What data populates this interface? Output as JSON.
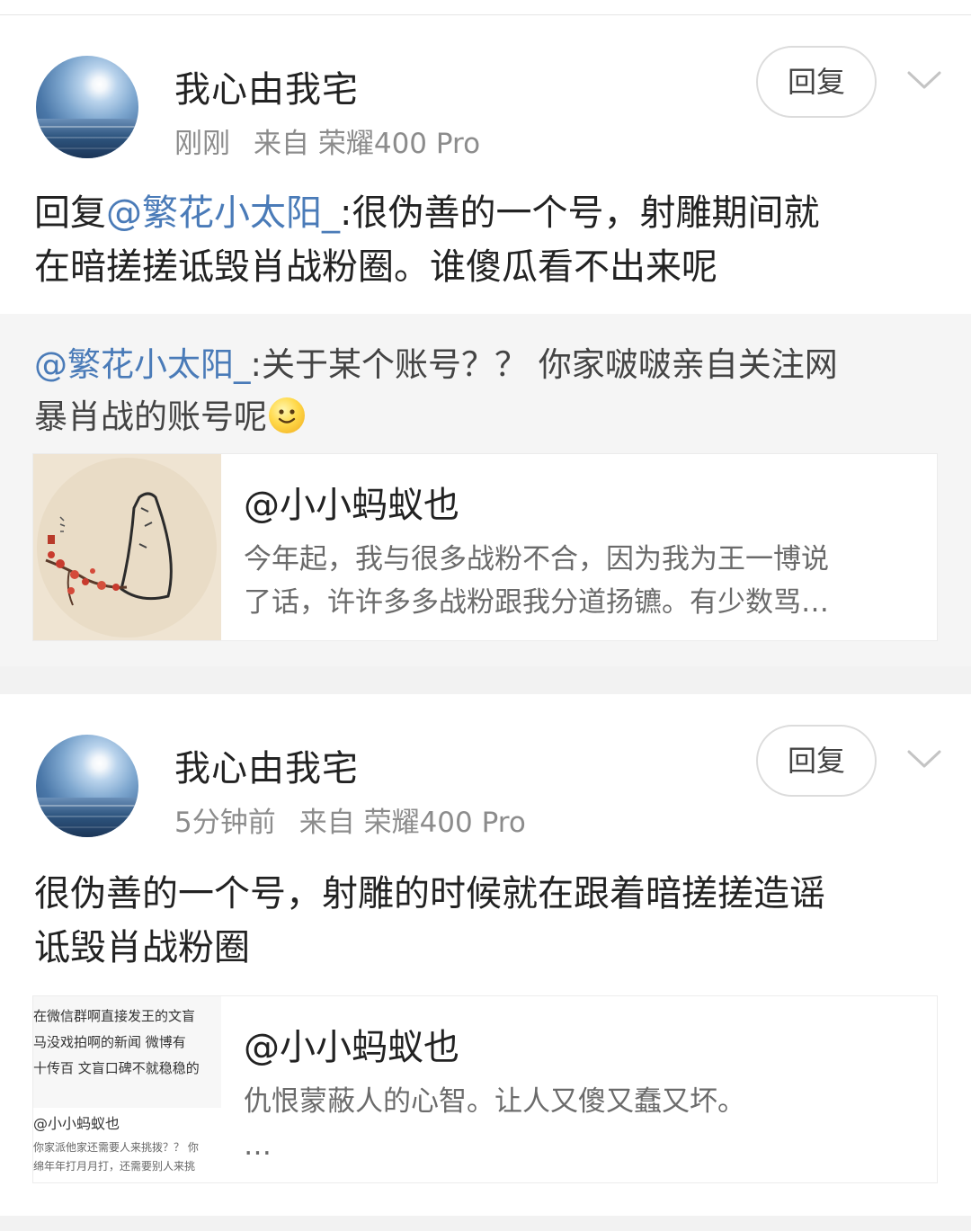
{
  "posts": [
    {
      "username": "我心由我宅",
      "time": "刚刚",
      "source": "来自 荣耀400 Pro",
      "reply_label": "回复",
      "text_prefix": "回复",
      "text_mention": "@繁花小太阳_",
      "text_line1_rest": ":很伪善的一个号，射雕期间就",
      "text_line2": "在暗搓搓诋毁肖战粉圈。谁傻瓜看不出来呢",
      "quote": {
        "mention": "@繁花小太阳_",
        "line1_rest": ":关于某个账号？？ 你家啵啵亲自关注网",
        "line2": "暴肖战的账号呢",
        "emoji": "smile-emoji"
      },
      "link_card": {
        "title": "@小小蚂蚁也",
        "desc_line1": "今年起，我与很多战粉不合，因为我为王一博说",
        "desc_line2": "了话，许许多多战粉跟我分道扬镳。有少数骂…"
      }
    },
    {
      "username": "我心由我宅",
      "time": "5分钟前",
      "source": "来自 荣耀400 Pro",
      "reply_label": "回复",
      "text_line1": "很伪善的一个号，射雕的时候就在跟着暗搓搓造谣",
      "text_line2": "诋毁肖战粉圈",
      "link_card": {
        "title": "@小小蚂蚁也",
        "desc_line1": "仇恨蒙蔽人的心智。让人又傻又蠢又坏。",
        "ellipsis": "…",
        "thumb_lines": [
          "在微信群啊直接发王的文盲",
          "马没戏拍啊的新闻 微博有",
          "十传百  文盲口碑不就稳稳的"
        ],
        "thumb_user": "@小小蚂蚁也",
        "thumb_lines2": [
          "你家派他家还需要人来挑拨？？ 你",
          "绵年年打月月打，还需要别人来挑"
        ]
      }
    }
  ]
}
